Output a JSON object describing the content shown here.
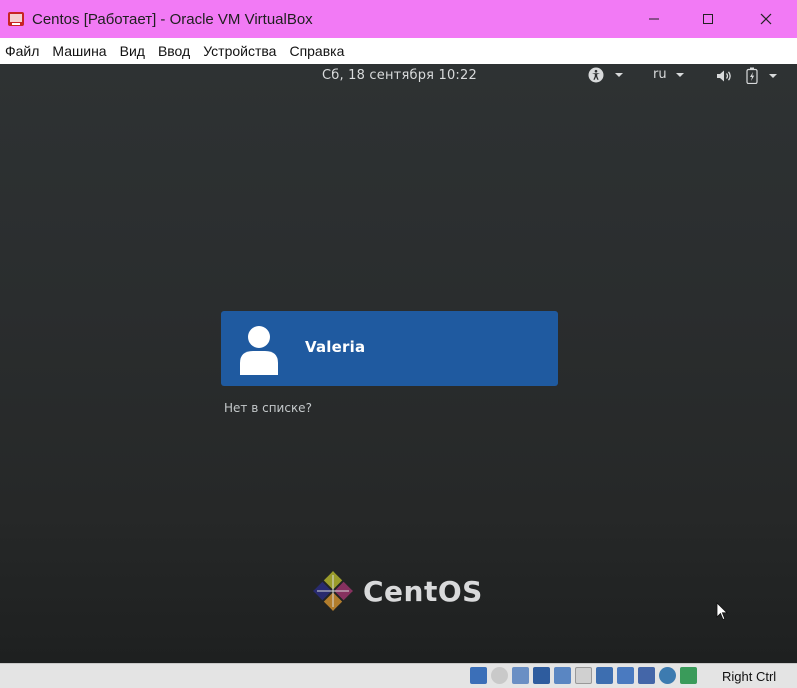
{
  "window": {
    "title": "Centos [Работает] - Oracle VM VirtualBox"
  },
  "menu": {
    "items": [
      {
        "label": "Файл"
      },
      {
        "label": "Машина"
      },
      {
        "label": "Вид"
      },
      {
        "label": "Ввод"
      },
      {
        "label": "Устройства"
      },
      {
        "label": "Справка"
      }
    ]
  },
  "gnome": {
    "clock": "Сб, 18 сентября  10:22",
    "keyboard_layout": "ru",
    "icons": {
      "accessibility": "accessibility-icon",
      "volume": "volume-icon",
      "battery": "battery-icon",
      "dropdown": "chevron-down-icon"
    }
  },
  "login": {
    "user_name": "Valeria",
    "not_listed": "Нет в списке?"
  },
  "brand": {
    "name": "CentOS"
  },
  "statusbar": {
    "host_key": "Right Ctrl"
  },
  "colors": {
    "titlebar": "#f27af5",
    "user_card": "#1f5aa0",
    "screen_bg": "#2b2e2f"
  }
}
